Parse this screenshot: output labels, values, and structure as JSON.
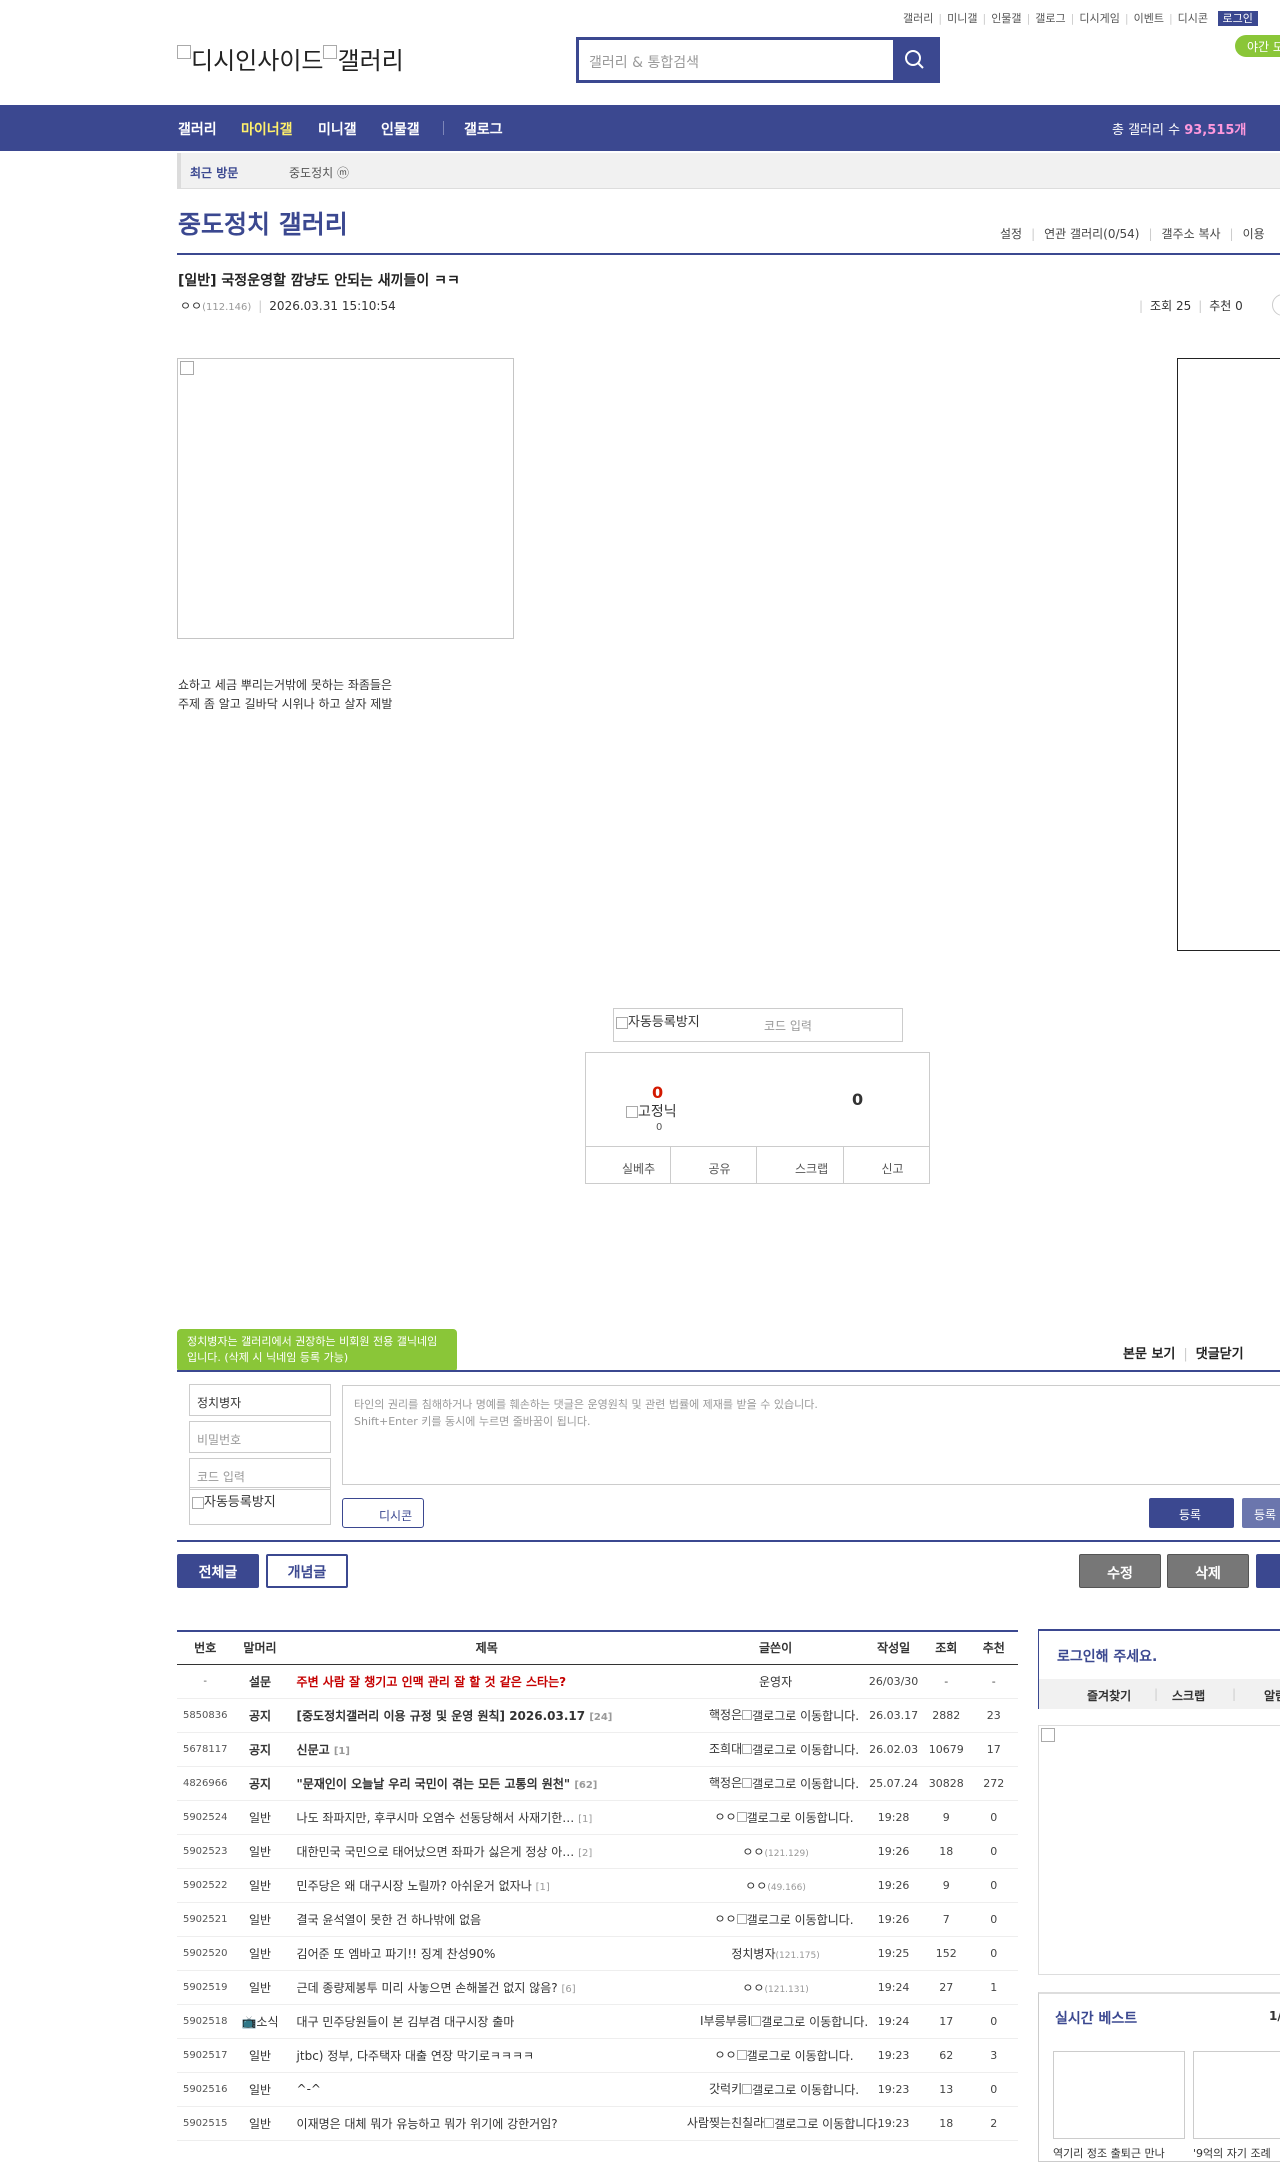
{
  "top_menu": [
    "갤러리",
    "미니갤",
    "인물갤",
    "갤로그",
    "디시게임",
    "이벤트",
    "디시콘"
  ],
  "login_label": "로그인",
  "night_mode": "야간 모",
  "logo": {
    "site": "디시인사이드",
    "gallery": "갤러리"
  },
  "search": {
    "placeholder": "갤러리 & 통합검색"
  },
  "gnb": {
    "items": [
      "갤러리",
      "마이너갤",
      "미니갤",
      "인물갤",
      "갤로그"
    ],
    "total_label": "총 갤러리 수",
    "total_value": "93,515개"
  },
  "recent": {
    "label": "최근 방문",
    "item": "중도정치 ⓜ"
  },
  "gallery_title": "중도정치 갤러리",
  "gallery_tabs": [
    "설정",
    "연관 갤러리(0/54)",
    "갤주소 복사",
    "이용"
  ],
  "post": {
    "title": "[일반] 국정운영할 깜냥도 안되는 새끼들이 ㅋㅋ",
    "writer": "ㅇㅇ",
    "writer_ip": "(112.146)",
    "date": "2026.03.31 15:10:54",
    "views": "조회 25",
    "recommend": "추천 0",
    "body_lines": [
      "쇼하고 세금 뿌리는거밖에 못하는 좌좀들은",
      "주제 좀 알고 길바닥 시위나 하고 살자 제발"
    ]
  },
  "captcha": {
    "alt": "자동등록방지",
    "placeholder": "코드 입력"
  },
  "recommend_box": {
    "up_count": "0",
    "up_name": "고정닉",
    "up_sub": "0",
    "down_count": "0",
    "buttons": [
      "실베추",
      "공유",
      "스크랩",
      "신고"
    ]
  },
  "comment": {
    "tooltip": "정치병자는 갤러리에서 권장하는 비회원 전용 갤닉네임입니다. (삭제 시 닉네임 등록 가능)",
    "links": [
      "본문 보기",
      "댓글닫기"
    ],
    "name_value": "정치병자",
    "password_placeholder": "비밀번호",
    "code_placeholder": "코드 입력",
    "captcha_alt": "자동등록방지",
    "textarea_line1": "타인의 권리를 침해하거나 명예를 훼손하는 댓글은 운영원칙 및 관련 법률에 제재를 받을 수 있습니다.",
    "textarea_line2": "Shift+Enter 키를 동시에 누르면 줄바꿈이 됩니다.",
    "dccon": "디시콘",
    "submit": "등록",
    "submit2": "등록"
  },
  "list_buttons": {
    "all": "전체글",
    "concept": "개념글",
    "edit": "수정",
    "delete": "삭제"
  },
  "table": {
    "headers": [
      "번호",
      "말머리",
      "제목",
      "글쓴이",
      "작성일",
      "조회",
      "추천"
    ],
    "rows": [
      {
        "num": "-",
        "sub": "설문",
        "title": "주변 사람 잘 챙기고 인맥 관리 잘 할 것 같은 스타는?",
        "rc": "",
        "writer": "운영자",
        "ip": "",
        "gallog": "",
        "date": "26/03/30",
        "views": "-",
        "rec": "-",
        "kind": "survey"
      },
      {
        "num": "5850836",
        "sub": "공지",
        "title": "[중도정치갤러리 이용 규정 및 운영 원칙] 2026.03.17",
        "rc": "[24]",
        "writer": "핵정은",
        "ip": "",
        "gallog": "갤로그로 이동합니다.",
        "date": "26.03.17",
        "views": "2882",
        "rec": "23",
        "kind": "notice"
      },
      {
        "num": "5678117",
        "sub": "공지",
        "title": "신문고",
        "rc": "[1]",
        "writer": "조희대",
        "ip": "",
        "gallog": "갤로그로 이동합니다.",
        "date": "26.02.03",
        "views": "10679",
        "rec": "17",
        "kind": "notice"
      },
      {
        "num": "4826966",
        "sub": "공지",
        "title": "\"문재인이 오늘날 우리 국민이 겪는 모든 고통의 원천\"",
        "rc": "[62]",
        "writer": "핵정은",
        "ip": "",
        "gallog": "갤로그로 이동합니다.",
        "date": "25.07.24",
        "views": "30828",
        "rec": "272",
        "kind": "notice"
      },
      {
        "num": "5902524",
        "sub": "일반",
        "title": "나도 좌파지만, 후쿠시마 오염수 선동당해서 사재기한…",
        "rc": "[1]",
        "writer": "ㅇㅇ",
        "ip": "",
        "gallog": "갤로그로 이동합니다.",
        "date": "19:28",
        "views": "9",
        "rec": "0",
        "kind": ""
      },
      {
        "num": "5902523",
        "sub": "일반",
        "title": "대한민국 국민으로 태어났으면 좌파가 싫은게 정상 아…",
        "rc": "[2]",
        "writer": "ㅇㅇ",
        "ip": "(121.129)",
        "gallog": "",
        "date": "19:26",
        "views": "18",
        "rec": "0",
        "kind": ""
      },
      {
        "num": "5902522",
        "sub": "일반",
        "title": "민주당은 왜 대구시장 노릴까? 아쉬운거 없자나",
        "rc": "[1]",
        "writer": "ㅇㅇ",
        "ip": "(49.166)",
        "gallog": "",
        "date": "19:26",
        "views": "9",
        "rec": "0",
        "kind": ""
      },
      {
        "num": "5902521",
        "sub": "일반",
        "title": "결국 윤석열이 못한 건 하나밖에 없음",
        "rc": "",
        "writer": "ㅇㅇ",
        "ip": "",
        "gallog": "갤로그로 이동합니다.",
        "date": "19:26",
        "views": "7",
        "rec": "0",
        "kind": ""
      },
      {
        "num": "5902520",
        "sub": "일반",
        "title": "김어준 또 엠바고 파기!! 징계 찬성90%",
        "rc": "",
        "writer": "정치병자",
        "ip": "(121.175)",
        "gallog": "",
        "date": "19:25",
        "views": "152",
        "rec": "0",
        "kind": ""
      },
      {
        "num": "5902519",
        "sub": "일반",
        "title": "근데 종량제봉투 미리 사놓으면 손해볼건 없지 않음?",
        "rc": "[6]",
        "writer": "ㅇㅇ",
        "ip": "(121.131)",
        "gallog": "",
        "date": "19:24",
        "views": "27",
        "rec": "1",
        "kind": ""
      },
      {
        "num": "5902518",
        "sub": "📺소식",
        "title": "대구 민주당원들이 본 김부겸 대구시장 출마",
        "rc": "",
        "writer": "I부릉부릉I",
        "ip": "",
        "gallog": "갤로그로 이동합니다.",
        "date": "19:24",
        "views": "17",
        "rec": "0",
        "kind": ""
      },
      {
        "num": "5902517",
        "sub": "일반",
        "title": "jtbc) 정부, 다주택자 대출 연장 막기로ㅋㅋㅋㅋ",
        "rc": "",
        "writer": "ㅇㅇ",
        "ip": "",
        "gallog": "갤로그로 이동합니다.",
        "date": "19:23",
        "views": "62",
        "rec": "3",
        "kind": ""
      },
      {
        "num": "5902516",
        "sub": "일반",
        "title": "^-^",
        "rc": "",
        "writer": "갓럭키",
        "ip": "",
        "gallog": "갤로그로 이동합니다.",
        "date": "19:23",
        "views": "13",
        "rec": "0",
        "kind": ""
      },
      {
        "num": "5902515",
        "sub": "일반",
        "title": "이재명은 대체 뭐가 유능하고 뭐가 위기에 강한거임?",
        "rc": "",
        "writer": "사람찢는친칠라",
        "ip": "",
        "gallog": "갤로그로 이동합니다.",
        "date": "19:23",
        "views": "18",
        "rec": "2",
        "kind": ""
      }
    ]
  },
  "login_box": {
    "title": "로그인해 주세요.",
    "items": [
      "즐겨찾기",
      "스크랩",
      "알림"
    ]
  },
  "realtime_best": {
    "title": "실시간 베스트",
    "page": "1/",
    "captions": [
      "역기리 정조 출퇴근 만나",
      "'9억의 자기 조례"
    ]
  },
  "colors": {
    "brand": "#3b4890",
    "accent": "#8ac638",
    "highlight": "#fff06b",
    "survey": "#c50000"
  }
}
